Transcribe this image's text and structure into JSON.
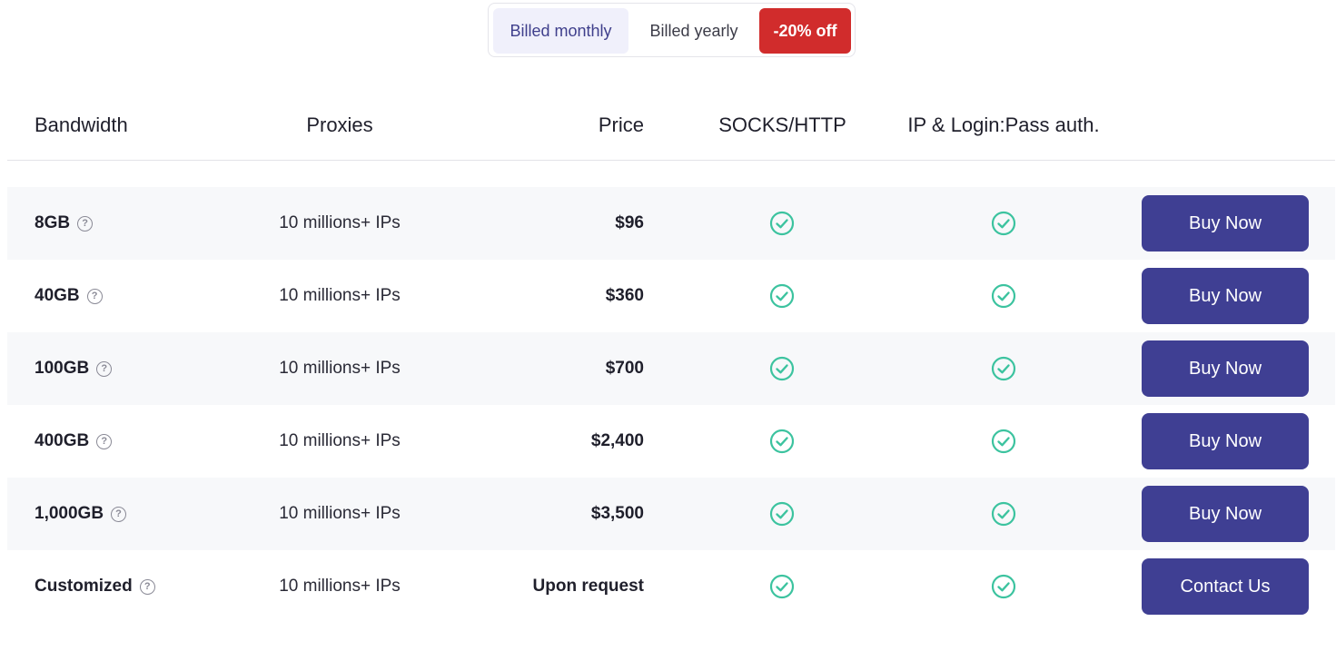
{
  "billing": {
    "monthly": "Billed monthly",
    "yearly": "Billed yearly",
    "discount": "-20% off"
  },
  "headers": {
    "bandwidth": "Bandwidth",
    "proxies": "Proxies",
    "price": "Price",
    "socks_http": "SOCKS/HTTP",
    "auth": "IP & Login:Pass auth."
  },
  "icons": {
    "check": "check-circle-icon",
    "help": "help-circle-icon",
    "help_glyph": "?"
  },
  "colors": {
    "primary": "#3f3f93",
    "discount": "#d12c2c",
    "check": "#3cc39f"
  },
  "plans": [
    {
      "bandwidth": "8GB",
      "proxies": "10 millions+ IPs",
      "price": "$96",
      "action": "Buy Now"
    },
    {
      "bandwidth": "40GB",
      "proxies": "10 millions+ IPs",
      "price": "$360",
      "action": "Buy Now"
    },
    {
      "bandwidth": "100GB",
      "proxies": "10 millions+ IPs",
      "price": "$700",
      "action": "Buy Now"
    },
    {
      "bandwidth": "400GB",
      "proxies": "10 millions+ IPs",
      "price": "$2,400",
      "action": "Buy Now"
    },
    {
      "bandwidth": "1,000GB",
      "proxies": "10 millions+ IPs",
      "price": "$3,500",
      "action": "Buy Now"
    },
    {
      "bandwidth": "Customized",
      "proxies": "10 millions+ IPs",
      "price": "Upon request",
      "action": "Contact Us"
    }
  ]
}
